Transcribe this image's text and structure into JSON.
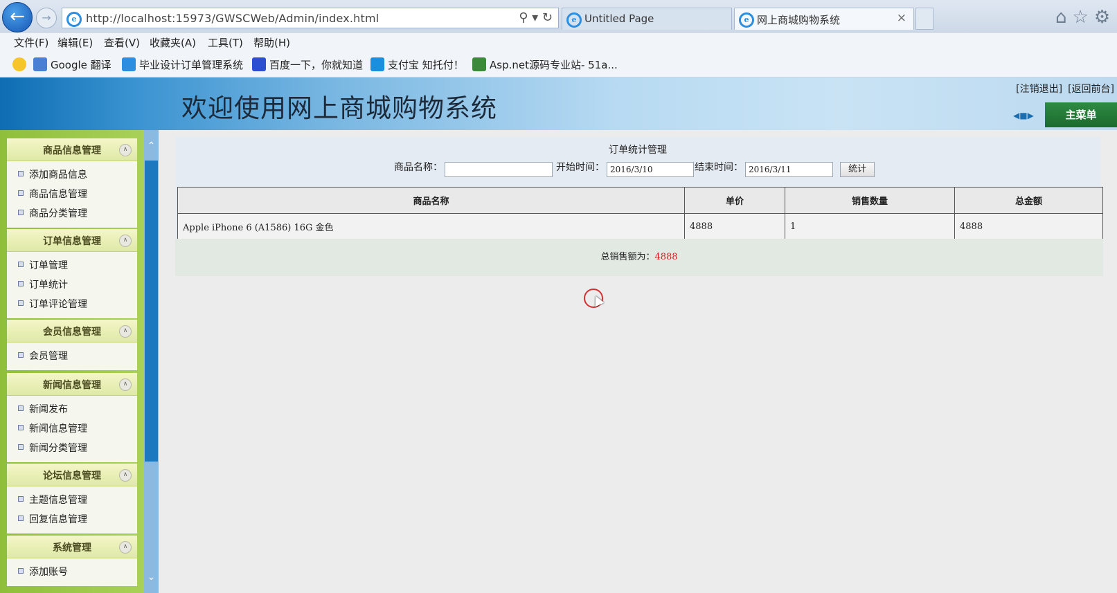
{
  "browser": {
    "address_url": "http://localhost:15973/GWSCWeb/Admin/index.html",
    "tabs": [
      {
        "label": "Untitled Page"
      },
      {
        "label": "网上商城购物系统"
      }
    ],
    "menu": [
      "文件(F)",
      "编辑(E)",
      "查看(V)",
      "收藏夹(A)",
      "工具(T)",
      "帮助(H)"
    ],
    "favorites": [
      {
        "label": "Google 翻译",
        "icon": "google-translate-icon",
        "color": "#4a7fd6"
      },
      {
        "label": "毕业设计订单管理系统",
        "icon": "ie-page-icon",
        "color": "#2b8ee0"
      },
      {
        "label": "百度一下，你就知道",
        "icon": "baidu-paw-icon",
        "color": "#2c4fd2"
      },
      {
        "label": "支付宝 知托付！",
        "icon": "alipay-icon",
        "color": "#1a8fe0"
      },
      {
        "label": "Asp.net源码专业站- 51a...",
        "icon": "aspnet-icon",
        "color": "#3a8a3a"
      }
    ]
  },
  "site": {
    "title": "欢迎使用网上商城购物系统",
    "logout_link": "[注销退出]",
    "back_link": "[返回前台]",
    "main_menu_button": "主菜单"
  },
  "sidebar": {
    "groups": [
      {
        "title": "商品信息管理",
        "items": [
          "添加商品信息",
          "商品信息管理",
          "商品分类管理"
        ]
      },
      {
        "title": "订单信息管理",
        "items": [
          "订单管理",
          "订单统计",
          "订单评论管理"
        ]
      },
      {
        "title": "会员信息管理",
        "items": [
          "会员管理"
        ]
      },
      {
        "title": "新闻信息管理",
        "items": [
          "新闻发布",
          "新闻信息管理",
          "新闻分类管理"
        ]
      },
      {
        "title": "论坛信息管理",
        "items": [
          "主题信息管理",
          "回复信息管理"
        ]
      },
      {
        "title": "系统管理",
        "items": [
          "添加账号"
        ]
      }
    ]
  },
  "content": {
    "panel_title": "订单统计管理",
    "filter": {
      "product_name_label": "商品名称：",
      "product_name_value": "",
      "start_label": "开始时间：",
      "start_value": "2016/3/10",
      "end_label": "结束时间：",
      "end_value": "2016/3/11",
      "submit_label": "统计"
    },
    "table": {
      "headers": [
        "商品名称",
        "单价",
        "销售数量",
        "总金额"
      ],
      "rows": [
        [
          "Apple iPhone 6 (A1586) 16G 金色",
          "4888",
          "1",
          "4888"
        ]
      ]
    },
    "total_label": "总销售额为：",
    "total_value": "4888"
  },
  "colors": {
    "accent_green": "#1c6a2e",
    "total_red": "#d02020"
  }
}
